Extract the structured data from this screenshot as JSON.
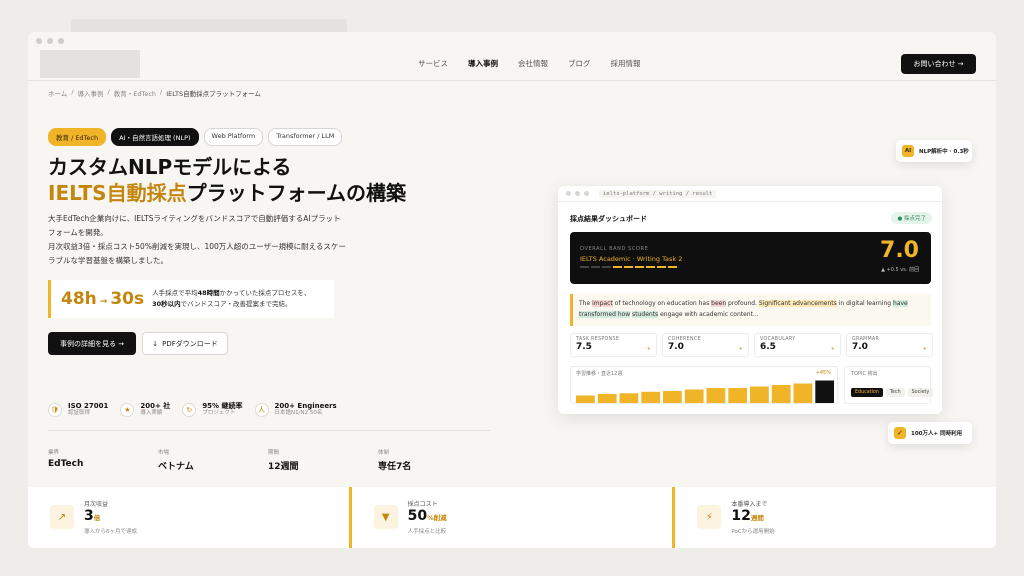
{
  "nav": {
    "items": [
      "サービス",
      "導入事例",
      "会社情報",
      "ブログ",
      "採用情報"
    ],
    "active_index": 1,
    "cta": "お問い合わせ →"
  },
  "breadcrumb": [
    "ホーム",
    "導入事例",
    "教育・EdTech",
    "IELTS自動採点プラットフォーム"
  ],
  "hero": {
    "tags": [
      "教育 / EdTech",
      "AI・自然言語処理 (NLP)",
      "Web Platform",
      "Transformer / LLM"
    ],
    "title_line1": "カスタムNLPモデルによる",
    "title_accent": "IELTS自動採点",
    "title_rest": "プラットフォームの構築",
    "lead_1": "大手EdTech企業向けに、IELTSライティングをバンドスコアで自動評価するAIプラットフォームを開発。",
    "lead_2": "月次収益3倍・採点コスト50%削減を実現し、100万人超のユーザー規模に耐えるスケーラブルな学習基盤を構築しました。",
    "stat_from": "48h",
    "stat_arrow": "→",
    "stat_to": "30s",
    "stat_desc_a": "人手採点で平均",
    "stat_desc_b": "48時間",
    "stat_desc_c": "かかっていた採点プロセスを、",
    "stat_desc_d": "30秒以内",
    "stat_desc_e": "でバンドスコア・改善提案まで完結。",
    "btn_primary": "事例の詳細を見る →",
    "btn_secondary": "PDFダウンロード",
    "download_icon": "↓"
  },
  "badges": [
    {
      "icon": "🛡",
      "title": "ISO 27001",
      "sub": "認証取得"
    },
    {
      "icon": "★",
      "title": "200+ 社",
      "sub": "導入実績"
    },
    {
      "icon": "↻",
      "title": "95% 継続率",
      "sub": "プロジェクト"
    },
    {
      "icon": "人",
      "title": "200+ Engineers",
      "sub": "日本語N1/N2 50名"
    }
  ],
  "facts": [
    {
      "label": "業界",
      "value": "EdTech"
    },
    {
      "label": "市場",
      "value": "ベトナム"
    },
    {
      "label": "期間",
      "value": "12週間"
    },
    {
      "label": "体制",
      "value": "専任7名"
    }
  ],
  "kpis": [
    {
      "icon": "↗",
      "label": "月次収益",
      "value": "3",
      "unit": "倍",
      "sub": "導入から6ヶ月で達成"
    },
    {
      "icon": "▼",
      "label": "採点コスト",
      "value": "50",
      "unit": "%削減",
      "sub": "人手採点と比較"
    },
    {
      "icon": "⚡",
      "label": "本番導入まで",
      "value": "12",
      "unit": "週間",
      "sub": "PoCから運用開始"
    }
  ],
  "dashboard": {
    "path": "ielts-platform / writing / result",
    "title": "採点結果ダッシュボード",
    "status": "● 採点完了",
    "band_label": "OVERALL BAND SCORE",
    "band_sub": "IELTS Academic · Writing Task 2",
    "band_score": "7.0",
    "band_delta": "▲ +0.5 vs. 前回",
    "band_segments": 9,
    "band_segments_on": 6,
    "essay": [
      {
        "t": "The ",
        "c": ""
      },
      {
        "t": "impact",
        "c": "r"
      },
      {
        "t": " of technology on education has ",
        "c": ""
      },
      {
        "t": "been",
        "c": "r"
      },
      {
        "t": " profound. ",
        "c": ""
      },
      {
        "t": "Significant advancements",
        "c": "y"
      },
      {
        "t": " in digital learning ",
        "c": ""
      },
      {
        "t": "have transformed how",
        "c": "g"
      },
      {
        "t": " ",
        "c": ""
      },
      {
        "t": "students",
        "c": "g"
      },
      {
        "t": " engage with academic content...",
        "c": ""
      }
    ],
    "cards": [
      {
        "label": "TASK RESPONSE",
        "value": "7.5"
      },
      {
        "label": "COHERENCE",
        "value": "7.0"
      },
      {
        "label": "VOCABULARY",
        "value": "6.5"
      },
      {
        "label": "GRAMMAR",
        "value": "7.0"
      }
    ],
    "card_plus": "+",
    "chart_title": "学習推移・直近12週",
    "chart_growth": "+45%",
    "topic_title": "TOPIC 検出",
    "topics": [
      "Education",
      "Tech",
      "Society"
    ]
  },
  "chart_data": {
    "type": "bar",
    "categories": [
      "1",
      "2",
      "3",
      "4",
      "5",
      "6",
      "7",
      "8",
      "9",
      "10",
      "11",
      "12"
    ],
    "values": [
      5.0,
      5.2,
      5.3,
      5.5,
      5.6,
      5.8,
      6.0,
      6.0,
      6.2,
      6.4,
      6.6,
      7.0
    ],
    "title": "学習推移・直近12週",
    "ylim": [
      4,
      7.2
    ],
    "colors": {
      "normal": "#f0b429",
      "last": "#111111"
    }
  },
  "float_ai": {
    "badge": "AI",
    "text": "NLP解析中 · 0.3秒"
  },
  "float_users": {
    "icon": "✓",
    "text": "100万人+ 同時利用"
  },
  "colors": {
    "accent": "#f0b429",
    "accent_dark": "#c4860c",
    "ink": "#111111"
  }
}
